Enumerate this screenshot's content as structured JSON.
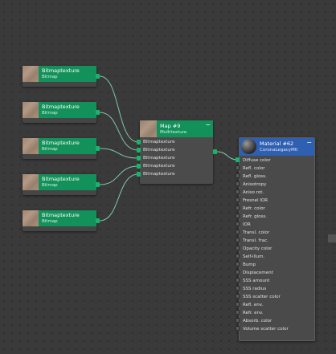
{
  "bitmap_nodes": [
    {
      "name": "Bitmaptexture",
      "type": "Bitmap"
    },
    {
      "name": "Bitmaptexture",
      "type": "Bitmap"
    },
    {
      "name": "Bitmaptexture",
      "type": "Bitmap"
    },
    {
      "name": "Bitmaptexture",
      "type": "Bitmap"
    },
    {
      "name": "Bitmaptexture",
      "type": "Bitmap"
    }
  ],
  "multi_node": {
    "name": "Map #9",
    "type": "Multitexture",
    "collapse": "−",
    "slots": [
      "Bitmaptexture",
      "Bitmaptexture",
      "Bitmaptexture",
      "Bitmaptexture",
      "Bitmaptexture"
    ]
  },
  "material_node": {
    "name": "Material #62",
    "type": "CoronaLegacyMtl",
    "collapse": "−",
    "slots": [
      "Diffuse color",
      "Refl. color",
      "Refl. gloss.",
      "Anisotropy",
      "Aniso rot.",
      "Fresnel IOR",
      "Refr. color",
      "Refr. gloss.",
      "IOR",
      "Transl. color",
      "Transl. frac.",
      "Opacity color",
      "Self-illum.",
      "Bump",
      "Displacement",
      "SSS amount",
      "SSS radius",
      "SSS scatter color",
      "Refl. env.",
      "Refr. env.",
      "Absorb. color",
      "Volume scatter color"
    ]
  },
  "colors": {
    "node_header_map": "#13915a",
    "node_header_material": "#2f5fb0",
    "wire": "#7fc9a8",
    "canvas": "#3a3a3a"
  }
}
